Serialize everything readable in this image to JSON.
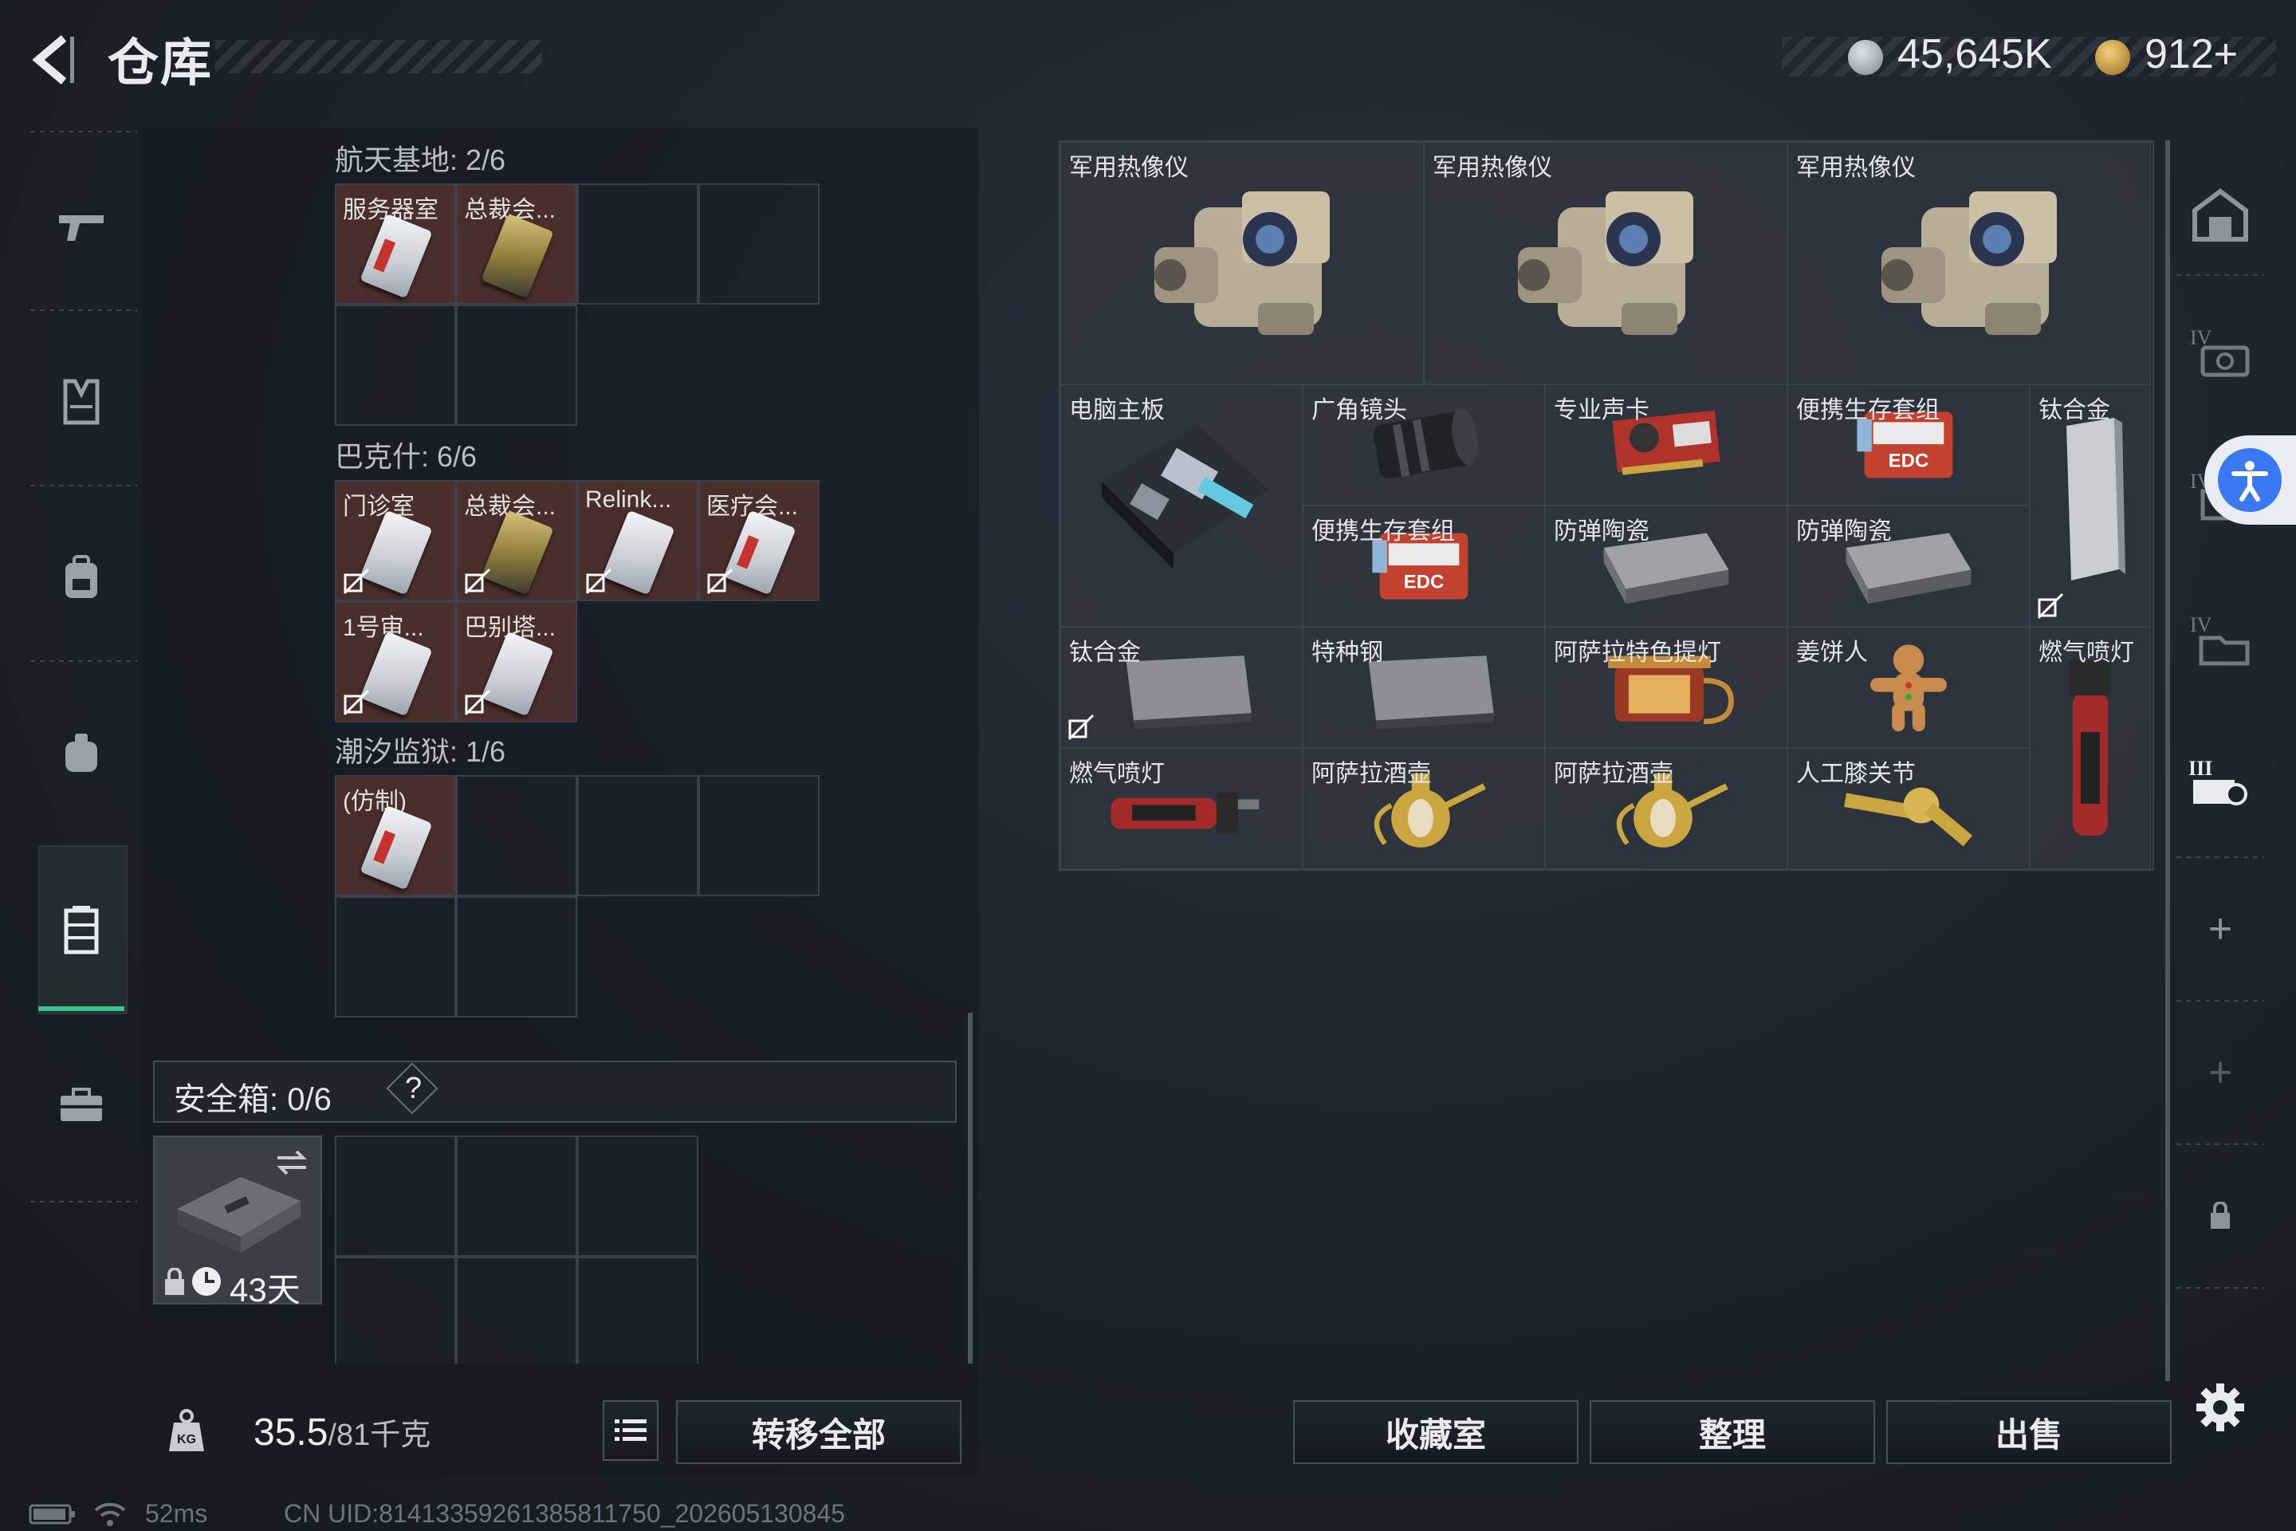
{
  "header": {
    "title": "仓库",
    "currency_silver": "45,645K",
    "currency_gold": "912+",
    "gold_plus": ""
  },
  "left": {
    "sections": [
      {
        "label": "航天基地: 2/6",
        "slots": [
          "服务器室",
          "总裁会..."
        ]
      },
      {
        "label": "巴克什: 6/6",
        "slots": [
          "门诊室",
          "总裁会...",
          "Relink...",
          "医疗会...",
          "1号审...",
          "巴别塔..."
        ]
      },
      {
        "label": "潮汐监狱: 1/6",
        "slots": [
          "(仿制)"
        ]
      }
    ],
    "safe_label": "安全箱: 0/6",
    "safe_help": "?",
    "safe_days": "43天",
    "weight_value": "35.5",
    "weight_max": "/81千克",
    "transfer_all": "转移全部"
  },
  "right": {
    "items": [
      {
        "name": "军用热像仪",
        "icon": "thermal-imager"
      },
      {
        "name": "军用热像仪",
        "icon": "thermal-imager"
      },
      {
        "name": "军用热像仪",
        "icon": "thermal-imager"
      },
      {
        "name": "电脑主板",
        "icon": "motherboard"
      },
      {
        "name": "广角镜头",
        "icon": "camera-lens"
      },
      {
        "name": "专业声卡",
        "icon": "sound-card"
      },
      {
        "name": "便携生存套组",
        "icon": "survival-kit"
      },
      {
        "name": "钛合金",
        "icon": "titanium-bar"
      },
      {
        "name": "便携生存套组",
        "icon": "survival-kit"
      },
      {
        "name": "防弹陶瓷",
        "icon": "ceramic-plate"
      },
      {
        "name": "防弹陶瓷",
        "icon": "ceramic-plate"
      },
      {
        "name": "钛合金",
        "icon": "titanium-bar"
      },
      {
        "name": "特种钢",
        "icon": "steel-bar"
      },
      {
        "name": "阿萨拉特色提灯",
        "icon": "lantern"
      },
      {
        "name": "姜饼人",
        "icon": "gingerbread"
      },
      {
        "name": "燃气喷灯",
        "icon": "gas-torch"
      },
      {
        "name": "燃气喷灯",
        "icon": "gas-torch"
      },
      {
        "name": "阿萨拉酒壶",
        "icon": "wine-jug"
      },
      {
        "name": "阿萨拉酒壶",
        "icon": "wine-jug"
      },
      {
        "name": "人工膝关节",
        "icon": "knee-joint"
      }
    ],
    "collection_button": "收藏室",
    "sort_button": "整理",
    "sell_button": "出售"
  },
  "status": {
    "ping": "52ms",
    "uid": "CN UID:8141335926138581175​0_202605130845"
  },
  "colors": {
    "accent_green": "#39c489",
    "slot_red": "#4a2e2c",
    "access_blue": "#3978f0"
  }
}
